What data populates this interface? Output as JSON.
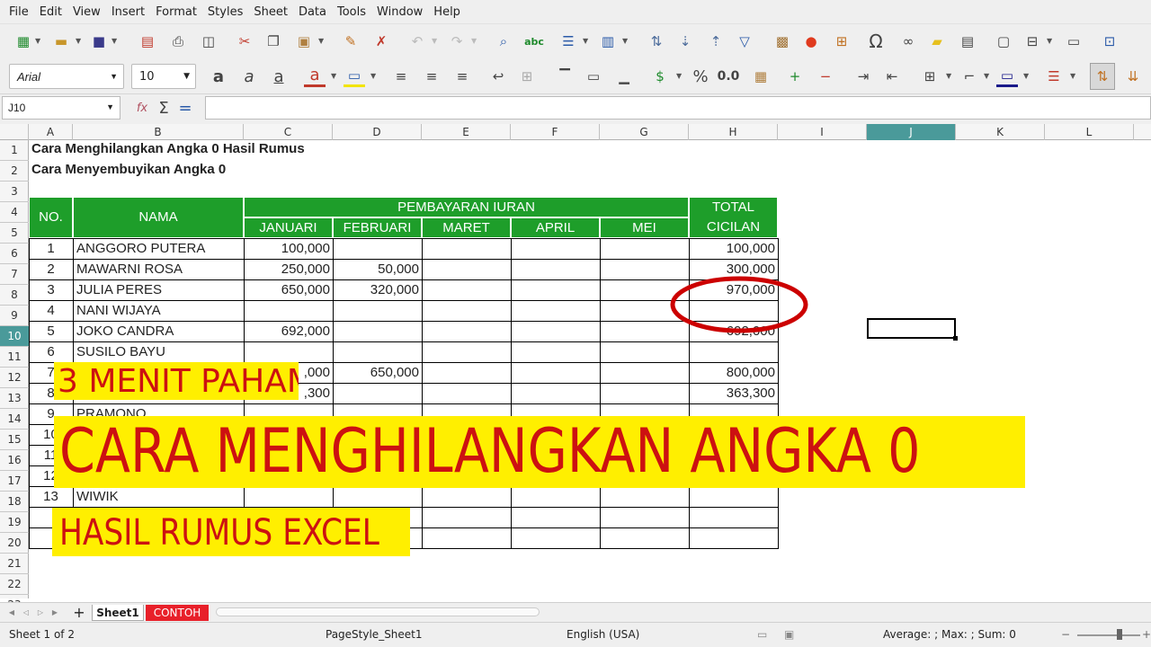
{
  "menu": [
    "File",
    "Edit",
    "View",
    "Insert",
    "Format",
    "Styles",
    "Sheet",
    "Data",
    "Tools",
    "Window",
    "Help"
  ],
  "toolbar": {
    "font_name": "Arial",
    "font_size": "10",
    "percent_label": "%",
    "number_label": "0.0",
    "sigma": "Σ",
    "equals": "="
  },
  "namebox": "J10",
  "columns": [
    "A",
    "B",
    "C",
    "D",
    "E",
    "F",
    "G",
    "H",
    "I",
    "J",
    "K",
    "L"
  ],
  "rows": [
    "1",
    "2",
    "3",
    "4",
    "5",
    "6",
    "7",
    "8",
    "9",
    "10",
    "11",
    "12",
    "13",
    "14",
    "15",
    "16",
    "17",
    "18",
    "19",
    "20",
    "21",
    "22",
    "23"
  ],
  "title1": "Cara Menghilangkan Angka 0 Hasil Rumus",
  "title2": "Cara Menyembuyikan Angka 0",
  "table_header": {
    "no": "NO.",
    "nama": "NAMA",
    "pembayaran": "PEMBAYARAN IURAN",
    "months": [
      "JANUARI",
      "FEBRUARI",
      "MARET",
      "APRIL",
      "MEI"
    ],
    "total_line1": "TOTAL",
    "total_line2": "CICILAN"
  },
  "table_rows": [
    {
      "no": "1",
      "nama": "ANGGORO PUTERA",
      "jan": "100,000",
      "feb": "",
      "total": "100,000"
    },
    {
      "no": "2",
      "nama": "MAWARNI ROSA",
      "jan": "250,000",
      "feb": "50,000",
      "total": "300,000"
    },
    {
      "no": "3",
      "nama": "JULIA PERES",
      "jan": "650,000",
      "feb": "320,000",
      "total": "970,000"
    },
    {
      "no": "4",
      "nama": "NANI WIJAYA",
      "jan": "",
      "feb": "",
      "total": ""
    },
    {
      "no": "5",
      "nama": "JOKO CANDRA",
      "jan": "692,000",
      "feb": "",
      "total": "692,000"
    },
    {
      "no": "6",
      "nama": "SUSILO BAYU",
      "jan": "",
      "feb": "",
      "total": ""
    },
    {
      "no": "7",
      "nama": "",
      "jan": ",000",
      "feb": "650,000",
      "total": "800,000"
    },
    {
      "no": "8",
      "nama": "",
      "jan": ",300",
      "feb": "",
      "total": "363,300"
    },
    {
      "no": "9",
      "nama": "PRAMONO",
      "jan": "",
      "feb": "",
      "total": ""
    },
    {
      "no": "10",
      "nama": "",
      "jan": "",
      "feb": "",
      "total": ""
    },
    {
      "no": "11",
      "nama": "",
      "jan": "",
      "feb": "",
      "total": ""
    },
    {
      "no": "12",
      "nama": "",
      "jan": "",
      "feb": "",
      "total": ""
    },
    {
      "no": "13",
      "nama": "WIWIK",
      "jan": "",
      "feb": "",
      "total": ""
    }
  ],
  "banners": {
    "top": "3 MENIT PAHAM",
    "main": "CARA MENGHILANGKAN ANGKA 0",
    "bottom": "HASIL RUMUS EXCEL"
  },
  "sheet_tabs": [
    "Sheet1",
    "CONTOH"
  ],
  "status": {
    "sheet": "Sheet 1 of 2",
    "pagestyle": "PageStyle_Sheet1",
    "language": "English (USA)",
    "summary": "Average: ; Max: ; Sum: 0"
  },
  "colors": {
    "header_green": "#1e9e2a",
    "banner_yellow": "#ffef00",
    "banner_red": "#cc1111",
    "circle_red": "#cc0000",
    "tab_red": "#e8202a"
  }
}
